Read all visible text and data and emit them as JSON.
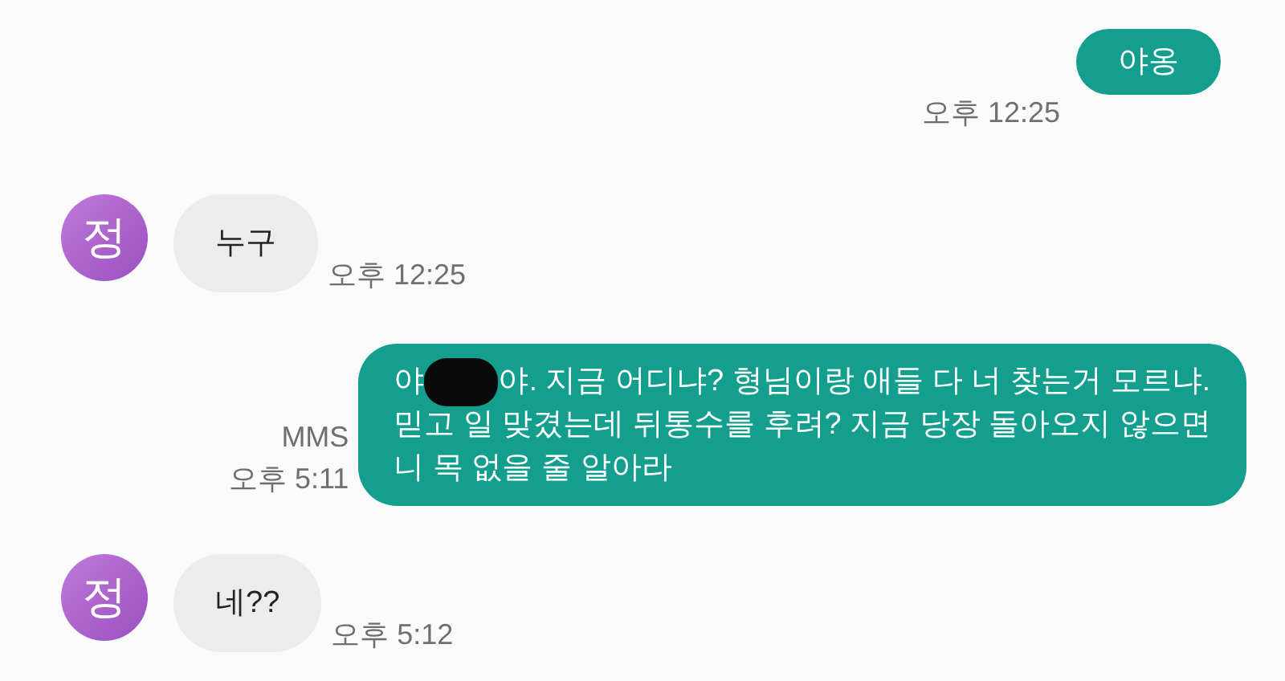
{
  "messages": [
    {
      "kind": "outgoing",
      "time": "오후 12:25",
      "parts": [
        {
          "kind": "text",
          "text": "야옹"
        }
      ]
    },
    {
      "kind": "incoming",
      "avatar": "정",
      "time": "오후 12:25",
      "parts": [
        {
          "kind": "text",
          "text": "누구"
        }
      ]
    },
    {
      "kind": "outgoing",
      "label": "MMS",
      "time": "오후 5:11",
      "parts": [
        {
          "kind": "text",
          "text": "야"
        },
        {
          "kind": "redaction"
        },
        {
          "kind": "text",
          "text": "야. 지금 어디냐? 형님이랑 애들 다 너 찾는거 모르냐.\n믿고 일 맞겼는데 뒤통수를 후려? 지금 당장 돌아오지 않으면\n니 목 없을 줄 알아라"
        }
      ]
    },
    {
      "kind": "incoming",
      "avatar": "정",
      "time": "오후 5:12",
      "parts": [
        {
          "kind": "text",
          "text": "네??"
        }
      ]
    }
  ]
}
